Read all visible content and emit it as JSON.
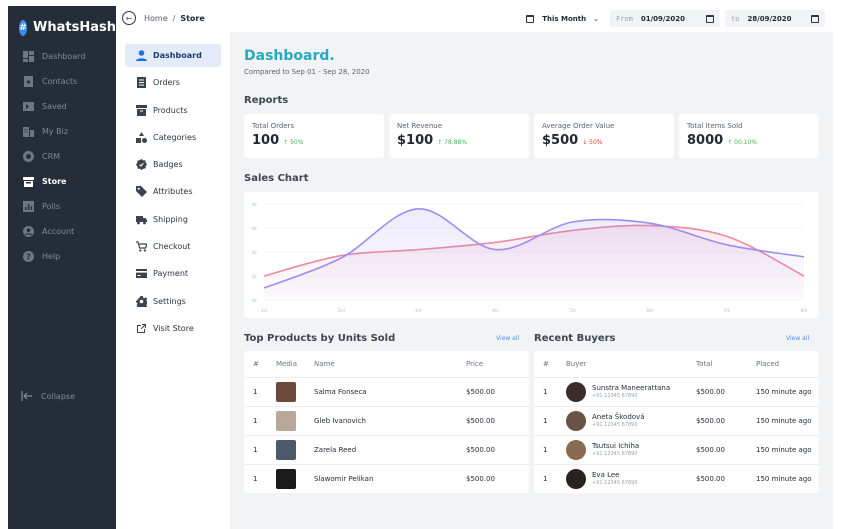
{
  "app": {
    "name": "WhatsHash"
  },
  "sidebar": {
    "items": [
      {
        "label": "Dashboard",
        "icon": "dashboard-icon",
        "active": false
      },
      {
        "label": "Contacts",
        "icon": "contacts-icon",
        "active": false
      },
      {
        "label": "Saved",
        "icon": "saved-icon",
        "active": false
      },
      {
        "label": "My Biz",
        "icon": "building-icon",
        "active": false
      },
      {
        "label": "CRM",
        "icon": "crm-icon",
        "active": false
      },
      {
        "label": "Store",
        "icon": "store-icon",
        "active": true
      },
      {
        "label": "Polls",
        "icon": "polls-icon",
        "active": false
      },
      {
        "label": "Account",
        "icon": "account-icon",
        "active": false
      },
      {
        "label": "Help",
        "icon": "help-icon",
        "active": false
      }
    ],
    "collapse_label": "Collapse"
  },
  "breadcrumb": {
    "home": "Home",
    "separator": "/",
    "current": "Store"
  },
  "filters": {
    "period": "This Month",
    "from_label": "From",
    "from_value": "01/09/2020",
    "to_label": "to",
    "to_value": "28/09/2020"
  },
  "subnav": {
    "items": [
      {
        "label": "Dashboard",
        "icon": "user-icon",
        "active": true
      },
      {
        "label": "Orders",
        "icon": "orders-icon",
        "active": false
      },
      {
        "label": "Products",
        "icon": "products-icon",
        "active": false
      },
      {
        "label": "Categories",
        "icon": "categories-icon",
        "active": false
      },
      {
        "label": "Badges",
        "icon": "badge-icon",
        "active": false
      },
      {
        "label": "Attributes",
        "icon": "tag-icon",
        "active": false
      },
      {
        "label": "Shipping",
        "icon": "truck-icon",
        "active": false
      },
      {
        "label": "Checkout",
        "icon": "cart-icon",
        "active": false
      },
      {
        "label": "Payment",
        "icon": "payment-icon",
        "active": false
      },
      {
        "label": "Settings",
        "icon": "gear-icon",
        "active": false
      },
      {
        "label": "Visit Store",
        "icon": "external-link-icon",
        "active": false
      }
    ]
  },
  "page": {
    "title": "Dashboard.",
    "subtitle": "Compared to Sep 01 - Sep 28, 2020",
    "reports_title": "Reports",
    "sales_chart_title": "Sales Chart",
    "top_products_title": "Top Products by Units Sold",
    "recent_buyers_title": "Recent Buyers",
    "view_all": "View all"
  },
  "reports": [
    {
      "label": "Total Orders",
      "value": "100",
      "change": "↑ 50%",
      "direction": "up"
    },
    {
      "label": "Net Revenue",
      "value": "$100",
      "change": "↑ 78.88%",
      "direction": "up"
    },
    {
      "label": "Average Order Value",
      "value": "$500",
      "change": "↓ 50%",
      "direction": "down"
    },
    {
      "label": "Total Items Sold",
      "value": "8000",
      "change": "↑ 00.10%",
      "direction": "up"
    }
  ],
  "chart_data": {
    "type": "area",
    "title": "Sales Chart",
    "xlabel": "",
    "ylabel": "",
    "x_ticks": [
      "1st",
      "2nd",
      "3rd",
      "4th",
      "5th",
      "6th",
      "7th",
      "8th"
    ],
    "y_ticks": [
      "8k",
      "6k",
      "4k",
      "2k",
      "0k"
    ],
    "ylim": [
      0,
      8
    ],
    "grid": true,
    "legend": "none",
    "series": [
      {
        "color": "#ea8aa3",
        "values": [
          2.0,
          3.7,
          4.2,
          4.8,
          5.8,
          6.2,
          5.3,
          2.0
        ]
      },
      {
        "color": "#9d8df1",
        "values": [
          1.0,
          3.5,
          7.6,
          4.2,
          6.5,
          6.4,
          4.6,
          3.6
        ]
      }
    ]
  },
  "top_products": {
    "headers": [
      "#",
      "Media",
      "Name",
      "Price"
    ],
    "rows": [
      {
        "rank": "1",
        "name": "Salma Fonseca",
        "price": "$500.00"
      },
      {
        "rank": "1",
        "name": "Gleb Ivanovich",
        "price": "$500.00"
      },
      {
        "rank": "1",
        "name": "Zarela Reed",
        "price": "$500.00"
      },
      {
        "rank": "1",
        "name": "Slawomir Pelikan",
        "price": "$500.00"
      }
    ]
  },
  "recent_buyers": {
    "headers": [
      "#",
      "Buyer",
      "Total",
      "Placed"
    ],
    "rows": [
      {
        "rank": "1",
        "name": "Sunstra Maneerattana",
        "phone": "+91 12345 67890",
        "total": "$500.00",
        "placed": "150 minute ago"
      },
      {
        "rank": "1",
        "name": "Aneta Škodová",
        "phone": "+91 12345 67890",
        "total": "$500.00",
        "placed": "150 minute ago"
      },
      {
        "rank": "1",
        "name": "Tsutsui Ichiha",
        "phone": "+91 12345 67890",
        "total": "$500.00",
        "placed": "150 minute ago"
      },
      {
        "rank": "1",
        "name": "Eva Lee",
        "phone": "+91 12345 67890",
        "total": "$500.00",
        "placed": "150 minute ago"
      }
    ]
  }
}
